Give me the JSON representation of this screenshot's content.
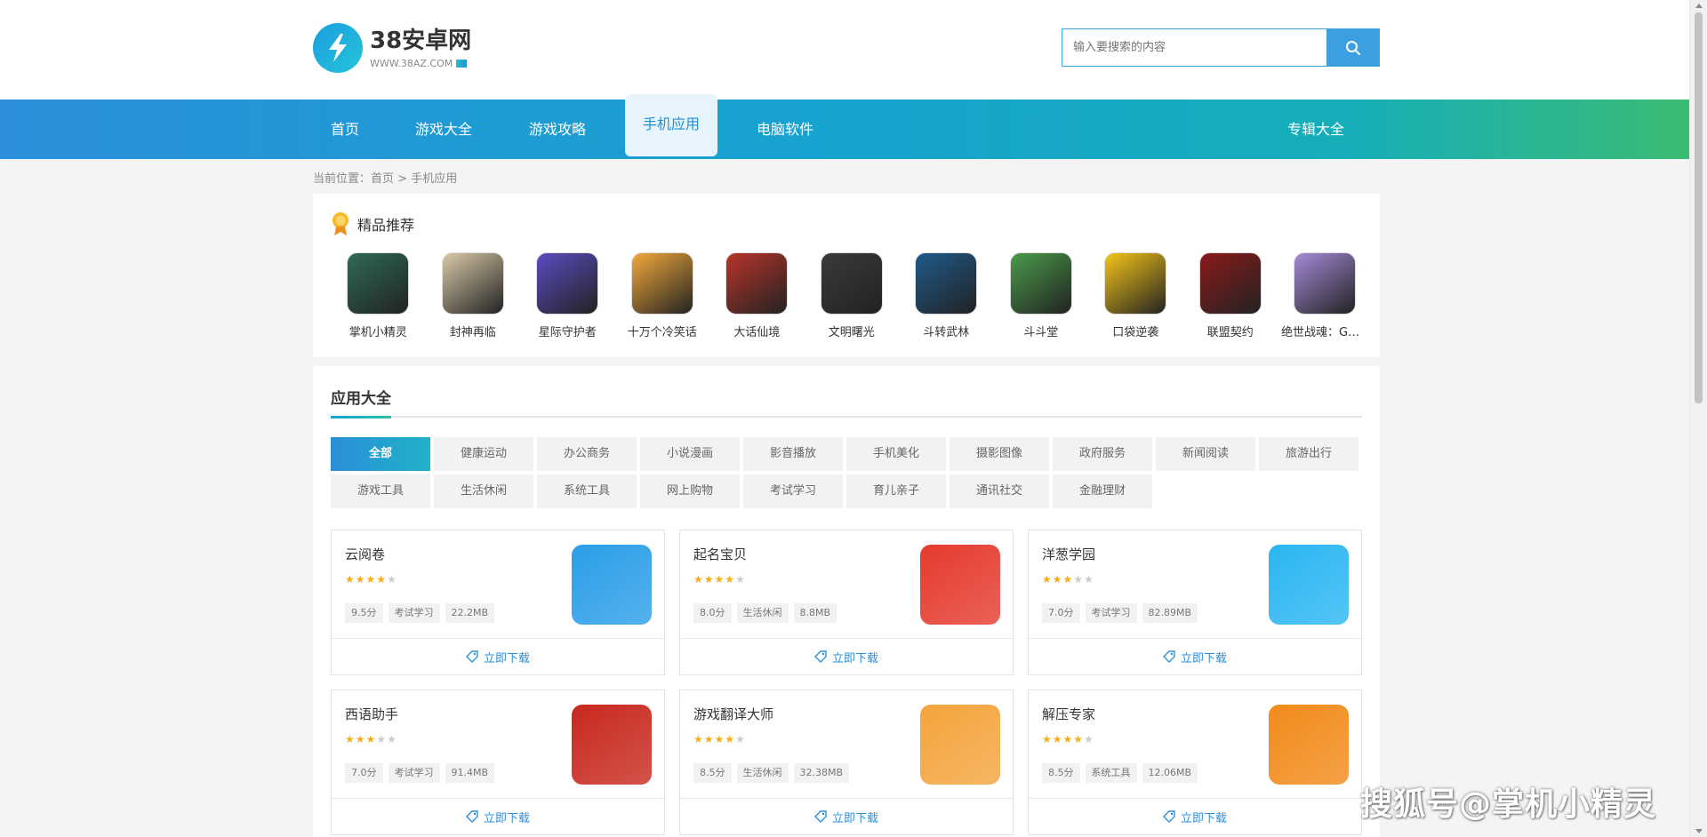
{
  "header": {
    "logo_name": "38安卓网",
    "logo_domain": "WWW.38AZ.COM",
    "search_placeholder": "输入要搜索的内容"
  },
  "nav": {
    "items": [
      "首页",
      "游戏大全",
      "游戏攻略",
      "手机应用",
      "电脑软件"
    ],
    "active": "手机应用",
    "right": "专辑大全"
  },
  "breadcrumb": {
    "prefix": "当前位置：",
    "home": "首页",
    "sep": ">",
    "current": "手机应用"
  },
  "featured": {
    "title": "精品推荐",
    "games": [
      {
        "name": "掌机小精灵",
        "color": "#2e6a55"
      },
      {
        "name": "封神再临",
        "color": "#d9c9a8"
      },
      {
        "name": "星际守护者",
        "color": "#5a4cc0"
      },
      {
        "name": "十万个冷笑话",
        "color": "#f2a93b"
      },
      {
        "name": "大话仙境",
        "color": "#b8342a"
      },
      {
        "name": "文明曙光",
        "color": "#3a3a3a"
      },
      {
        "name": "斗转武林",
        "color": "#1f5a8a"
      },
      {
        "name": "斗斗堂",
        "color": "#4a9a4a"
      },
      {
        "name": "口袋逆袭",
        "color": "#f5c518"
      },
      {
        "name": "联盟契约",
        "color": "#8a1a1a"
      },
      {
        "name": "绝世战魂：GM特权",
        "color": "#a68ad8"
      }
    ]
  },
  "apps_section": {
    "title": "应用大全",
    "categories": [
      "全部",
      "健康运动",
      "办公商务",
      "小说漫画",
      "影音播放",
      "手机美化",
      "摄影图像",
      "政府服务",
      "新闻阅读",
      "旅游出行",
      "游戏工具",
      "生活休闲",
      "系统工具",
      "网上购物",
      "考试学习",
      "育儿亲子",
      "通讯社交",
      "金融理财"
    ],
    "active_category": "全部",
    "download_label": "立即下载",
    "apps": [
      {
        "name": "云阅卷",
        "stars": 4,
        "score": "9.5分",
        "category": "考试学习",
        "size": "22.2MB",
        "icon_color": "#2a9ee8"
      },
      {
        "name": "起名宝贝",
        "stars": 4,
        "score": "8.0分",
        "category": "生活休闲",
        "size": "8.8MB",
        "icon_color": "#e53a2e"
      },
      {
        "name": "洋葱学园",
        "stars": 3,
        "score": "7.0分",
        "category": "考试学习",
        "size": "82.89MB",
        "icon_color": "#2ab6f2"
      },
      {
        "name": "西语助手",
        "stars": 3,
        "score": "7.0分",
        "category": "考试学习",
        "size": "91.4MB",
        "icon_color": "#c8281e"
      },
      {
        "name": "游戏翻译大师",
        "stars": 4,
        "score": "8.5分",
        "category": "生活休闲",
        "size": "32.38MB",
        "icon_color": "#f4a43c"
      },
      {
        "name": "解压专家",
        "stars": 4,
        "score": "8.5分",
        "category": "系统工具",
        "size": "12.06MB",
        "icon_color": "#f28a1a"
      }
    ]
  },
  "watermark": "搜狐号@掌机小精灵"
}
